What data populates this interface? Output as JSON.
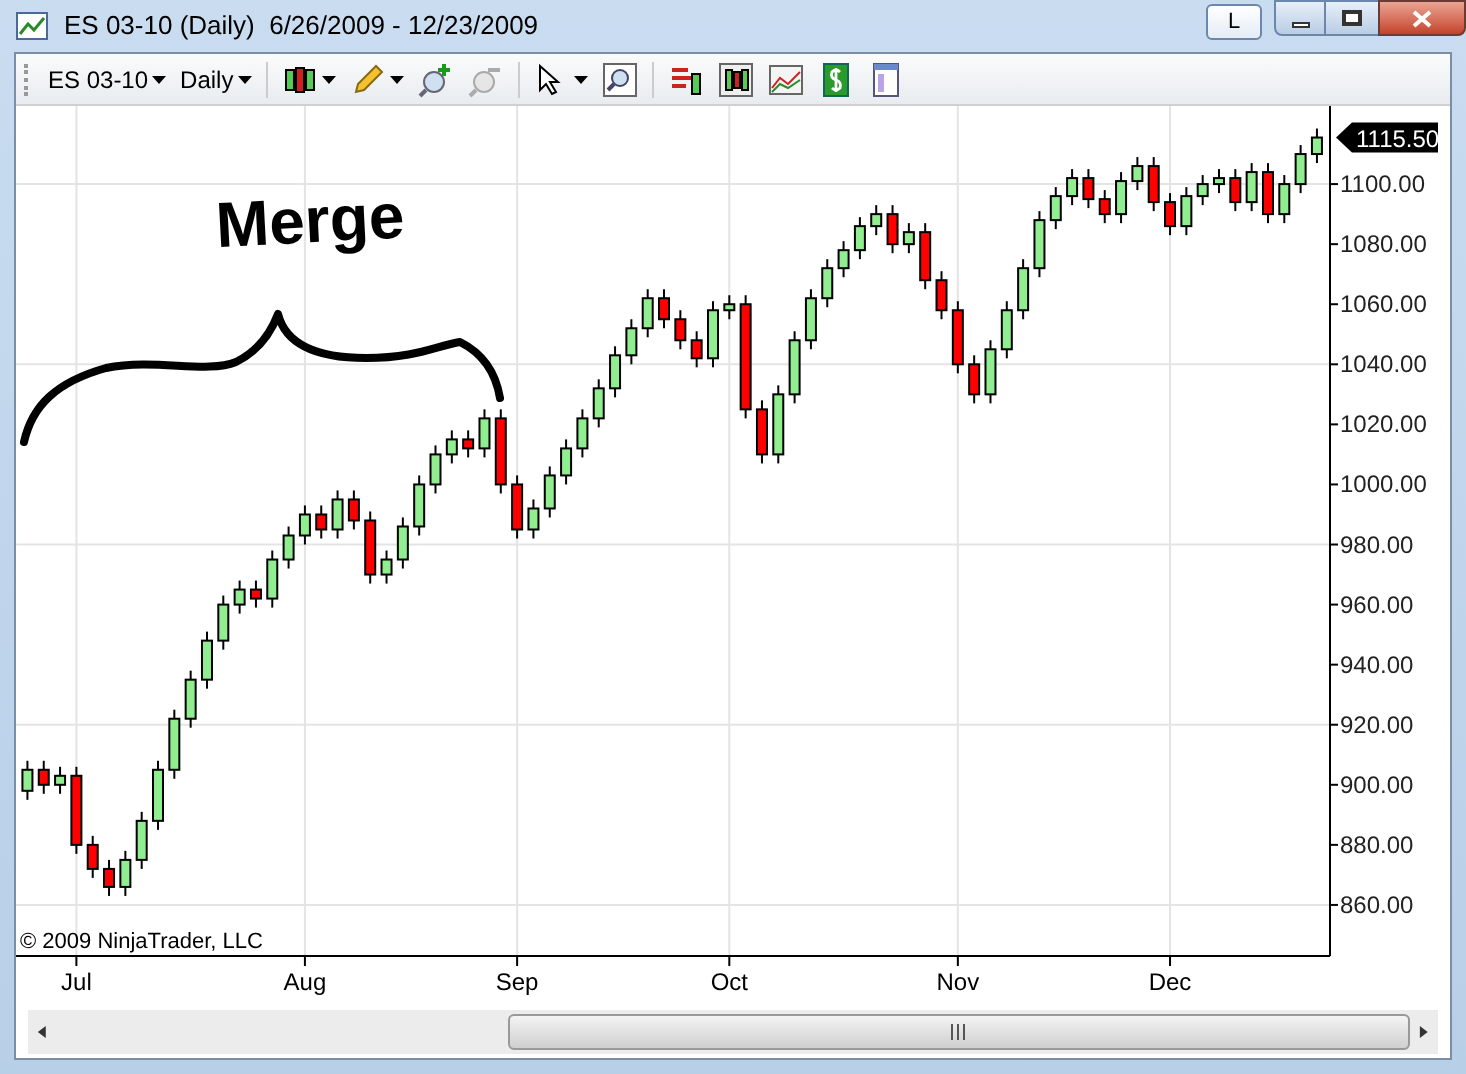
{
  "window": {
    "title": "ES 03-10 (Daily)  6/26/2009 - 12/23/2009",
    "layout_button": "L"
  },
  "toolbar": {
    "instrument": "ES 03-10",
    "interval": "Daily"
  },
  "chart": {
    "annotation": "Merge",
    "copyright": "© 2009 NinjaTrader, LLC",
    "price_tag": "1115.50",
    "chart_data": {
      "type": "candlestick",
      "grid": true,
      "ylim": [
        843,
        1126
      ],
      "categories": [
        null,
        null,
        null,
        "Jul",
        null,
        null,
        null,
        null,
        null,
        null,
        null,
        null,
        null,
        null,
        null,
        null,
        null,
        "Aug",
        null,
        null,
        null,
        null,
        null,
        null,
        null,
        null,
        null,
        null,
        null,
        null,
        "Sep",
        null,
        null,
        null,
        null,
        null,
        null,
        null,
        null,
        null,
        null,
        null,
        null,
        "Oct",
        null,
        null,
        null,
        null,
        null,
        null,
        null,
        null,
        null,
        null,
        null,
        null,
        null,
        "Nov",
        null,
        null,
        null,
        null,
        null,
        null,
        null,
        null,
        null,
        null,
        null,
        null,
        "Dec",
        null,
        null,
        null,
        null,
        null,
        null,
        null,
        null,
        null
      ],
      "yticks": [
        {
          "value": 1100,
          "label": "1100.00"
        },
        {
          "value": 1080,
          "label": "1080.00"
        },
        {
          "value": 1060,
          "label": "1060.00"
        },
        {
          "value": 1040,
          "label": "1040.00"
        },
        {
          "value": 1020,
          "label": "1020.00"
        },
        {
          "value": 1000,
          "label": "1000.00"
        },
        {
          "value": 980,
          "label": "980.00"
        },
        {
          "value": 960,
          "label": "960.00"
        },
        {
          "value": 940,
          "label": "940.00"
        },
        {
          "value": 920,
          "label": "920.00"
        },
        {
          "value": 900,
          "label": "900.00"
        },
        {
          "value": 880,
          "label": "880.00"
        },
        {
          "value": 860,
          "label": "860.00"
        }
      ],
      "ohlc": [
        [
          898,
          908,
          895,
          905
        ],
        [
          905,
          908,
          897,
          900
        ],
        [
          900,
          906,
          897,
          903
        ],
        [
          903,
          906,
          877,
          880
        ],
        [
          880,
          883,
          869,
          872
        ],
        [
          872,
          875,
          863,
          866
        ],
        [
          866,
          878,
          863,
          875
        ],
        [
          875,
          891,
          872,
          888
        ],
        [
          888,
          908,
          885,
          905
        ],
        [
          905,
          925,
          902,
          922
        ],
        [
          922,
          938,
          919,
          935
        ],
        [
          935,
          951,
          932,
          948
        ],
        [
          948,
          963,
          945,
          960
        ],
        [
          960,
          968,
          957,
          965
        ],
        [
          965,
          968,
          959,
          962
        ],
        [
          962,
          978,
          959,
          975
        ],
        [
          975,
          986,
          972,
          983
        ],
        [
          983,
          993,
          980,
          990
        ],
        [
          990,
          993,
          982,
          985
        ],
        [
          985,
          998,
          982,
          995
        ],
        [
          995,
          998,
          985,
          988
        ],
        [
          988,
          991,
          967,
          970
        ],
        [
          970,
          978,
          967,
          975
        ],
        [
          975,
          989,
          972,
          986
        ],
        [
          986,
          1003,
          983,
          1000
        ],
        [
          1000,
          1013,
          997,
          1010
        ],
        [
          1010,
          1018,
          1007,
          1015
        ],
        [
          1015,
          1018,
          1009,
          1012
        ],
        [
          1012,
          1025,
          1009,
          1022
        ],
        [
          1022,
          1025,
          997,
          1000
        ],
        [
          1000,
          1003,
          982,
          985
        ],
        [
          985,
          995,
          982,
          992
        ],
        [
          992,
          1006,
          989,
          1003
        ],
        [
          1003,
          1015,
          1000,
          1012
        ],
        [
          1012,
          1025,
          1009,
          1022
        ],
        [
          1022,
          1035,
          1019,
          1032
        ],
        [
          1032,
          1046,
          1029,
          1043
        ],
        [
          1043,
          1055,
          1040,
          1052
        ],
        [
          1052,
          1065,
          1049,
          1062
        ],
        [
          1062,
          1065,
          1052,
          1055
        ],
        [
          1055,
          1058,
          1045,
          1048
        ],
        [
          1048,
          1051,
          1039,
          1042
        ],
        [
          1042,
          1061,
          1039,
          1058
        ],
        [
          1058,
          1063,
          1055,
          1060
        ],
        [
          1060,
          1063,
          1022,
          1025
        ],
        [
          1025,
          1028,
          1007,
          1010
        ],
        [
          1010,
          1033,
          1007,
          1030
        ],
        [
          1030,
          1051,
          1027,
          1048
        ],
        [
          1048,
          1065,
          1045,
          1062
        ],
        [
          1062,
          1075,
          1059,
          1072
        ],
        [
          1072,
          1081,
          1069,
          1078
        ],
        [
          1078,
          1089,
          1075,
          1086
        ],
        [
          1086,
          1093,
          1083,
          1090
        ],
        [
          1090,
          1093,
          1077,
          1080
        ],
        [
          1080,
          1087,
          1077,
          1084
        ],
        [
          1084,
          1087,
          1065,
          1068
        ],
        [
          1068,
          1071,
          1055,
          1058
        ],
        [
          1058,
          1061,
          1037,
          1040
        ],
        [
          1040,
          1043,
          1027,
          1030
        ],
        [
          1030,
          1048,
          1027,
          1045
        ],
        [
          1045,
          1061,
          1042,
          1058
        ],
        [
          1058,
          1075,
          1055,
          1072
        ],
        [
          1072,
          1091,
          1069,
          1088
        ],
        [
          1088,
          1099,
          1085,
          1096
        ],
        [
          1096,
          1105,
          1093,
          1102
        ],
        [
          1102,
          1105,
          1092,
          1095
        ],
        [
          1095,
          1098,
          1087,
          1090
        ],
        [
          1090,
          1104,
          1087,
          1101
        ],
        [
          1101,
          1109,
          1098,
          1106
        ],
        [
          1106,
          1109,
          1091,
          1094
        ],
        [
          1094,
          1097,
          1083,
          1086
        ],
        [
          1086,
          1099,
          1083,
          1096
        ],
        [
          1096,
          1103,
          1093,
          1100
        ],
        [
          1100,
          1105,
          1097,
          1102
        ],
        [
          1102,
          1105,
          1091,
          1094
        ],
        [
          1094,
          1107,
          1091,
          1104
        ],
        [
          1104,
          1107,
          1087,
          1090
        ],
        [
          1090,
          1103,
          1087,
          1100
        ],
        [
          1100,
          1113,
          1097,
          1110
        ],
        [
          1110,
          1118.5,
          1107,
          1115.5
        ]
      ]
    }
  }
}
